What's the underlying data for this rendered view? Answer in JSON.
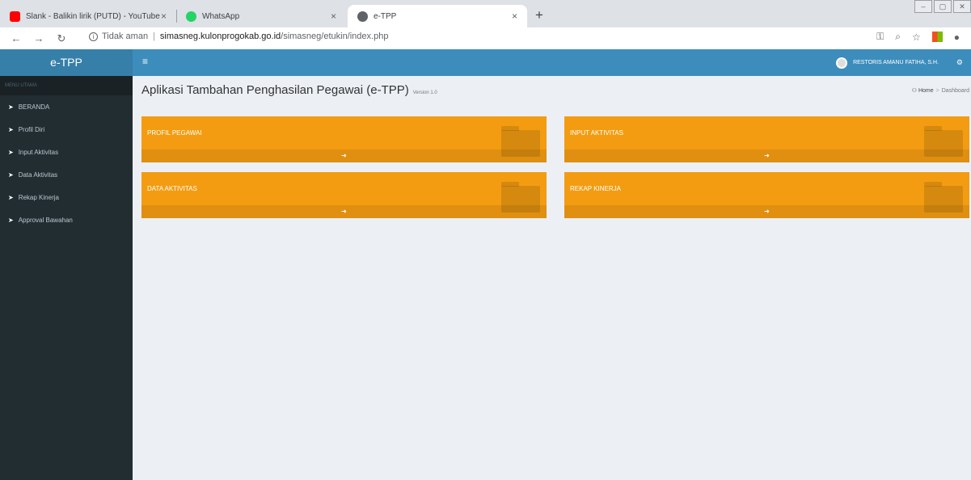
{
  "browser": {
    "tabs": [
      {
        "label": "Slank - Balikin lirik (PUTD) - YouTube",
        "close": "×"
      },
      {
        "label": "WhatsApp",
        "close": "×"
      },
      {
        "label": "e-TPP",
        "close": "×"
      }
    ],
    "new_tab": "+",
    "url_security": "Tidak aman",
    "url_host": "simasneg.kulonprogokab.go.id",
    "url_path": "/simasneg/etukin/index.php"
  },
  "app": {
    "logo": "e-TPP",
    "user_name": "RESTORIS AMANU FATIHA, S.H."
  },
  "sidebar": {
    "header": "MENU UTAMA",
    "items": [
      {
        "label": "BERANDA"
      },
      {
        "label": "Profil Diri"
      },
      {
        "label": "Input Aktivitas"
      },
      {
        "label": "Data Aktivitas"
      },
      {
        "label": "Rekap Kinerja"
      },
      {
        "label": "Approval Bawahan"
      }
    ]
  },
  "page": {
    "title": "Aplikasi Tambahan Penghasilan Pegawai (e-TPP)",
    "version": "Version 1.0",
    "breadcrumb": {
      "home": "Home",
      "current": "Dashboard"
    }
  },
  "boxes": [
    {
      "label": "PROFIL PEGAWAI"
    },
    {
      "label": "INPUT AKTIVITAS"
    },
    {
      "label": "DATA AKTIVITAS"
    },
    {
      "label": "REKAP KINERJA"
    }
  ],
  "colors": {
    "topbar": "#3c8dbc",
    "sidebar": "#222d32",
    "box": "#f39c12"
  },
  "icons": {
    "box_footer": "arrow-circle-right-icon",
    "menu": "paper-plane-icon"
  }
}
